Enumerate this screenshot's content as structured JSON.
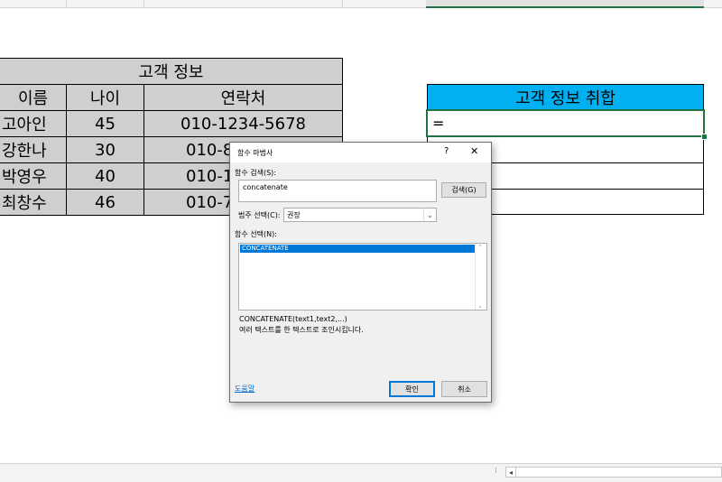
{
  "left_table": {
    "title": "고객 정보",
    "headers": [
      "이름",
      "나이",
      "연락처"
    ],
    "rows": [
      [
        "고아인",
        "45",
        "010-1234-5678"
      ],
      [
        "강한나",
        "30",
        "010-8"
      ],
      [
        "박영우",
        "40",
        "010-1"
      ],
      [
        "최창수",
        "46",
        "010-7"
      ]
    ]
  },
  "right_table": {
    "title": "고객 정보 취합",
    "active_cell_value": "="
  },
  "dialog": {
    "title": "함수 마법사",
    "help_glyph": "?",
    "close_glyph": "✕",
    "search_label": "함수 검색(S):",
    "search_value": "concatenate",
    "search_button": "검색(G)",
    "category_label": "범주 선택(C):",
    "category_value": "권장",
    "function_label": "함수 선택(N):",
    "functions": [
      "CONCATENATE"
    ],
    "signature": "CONCATENATE(text1,text2,...)",
    "description": "여러 텍스트를 한 텍스트로 조인시킵니다.",
    "help_link": "도움말",
    "ok_button": "확인",
    "cancel_button": "취소"
  },
  "colors": {
    "header_fill": "#d0cece",
    "accent_blue": "#00b0f0",
    "selection_green": "#217346",
    "list_selection": "#0078d7"
  }
}
